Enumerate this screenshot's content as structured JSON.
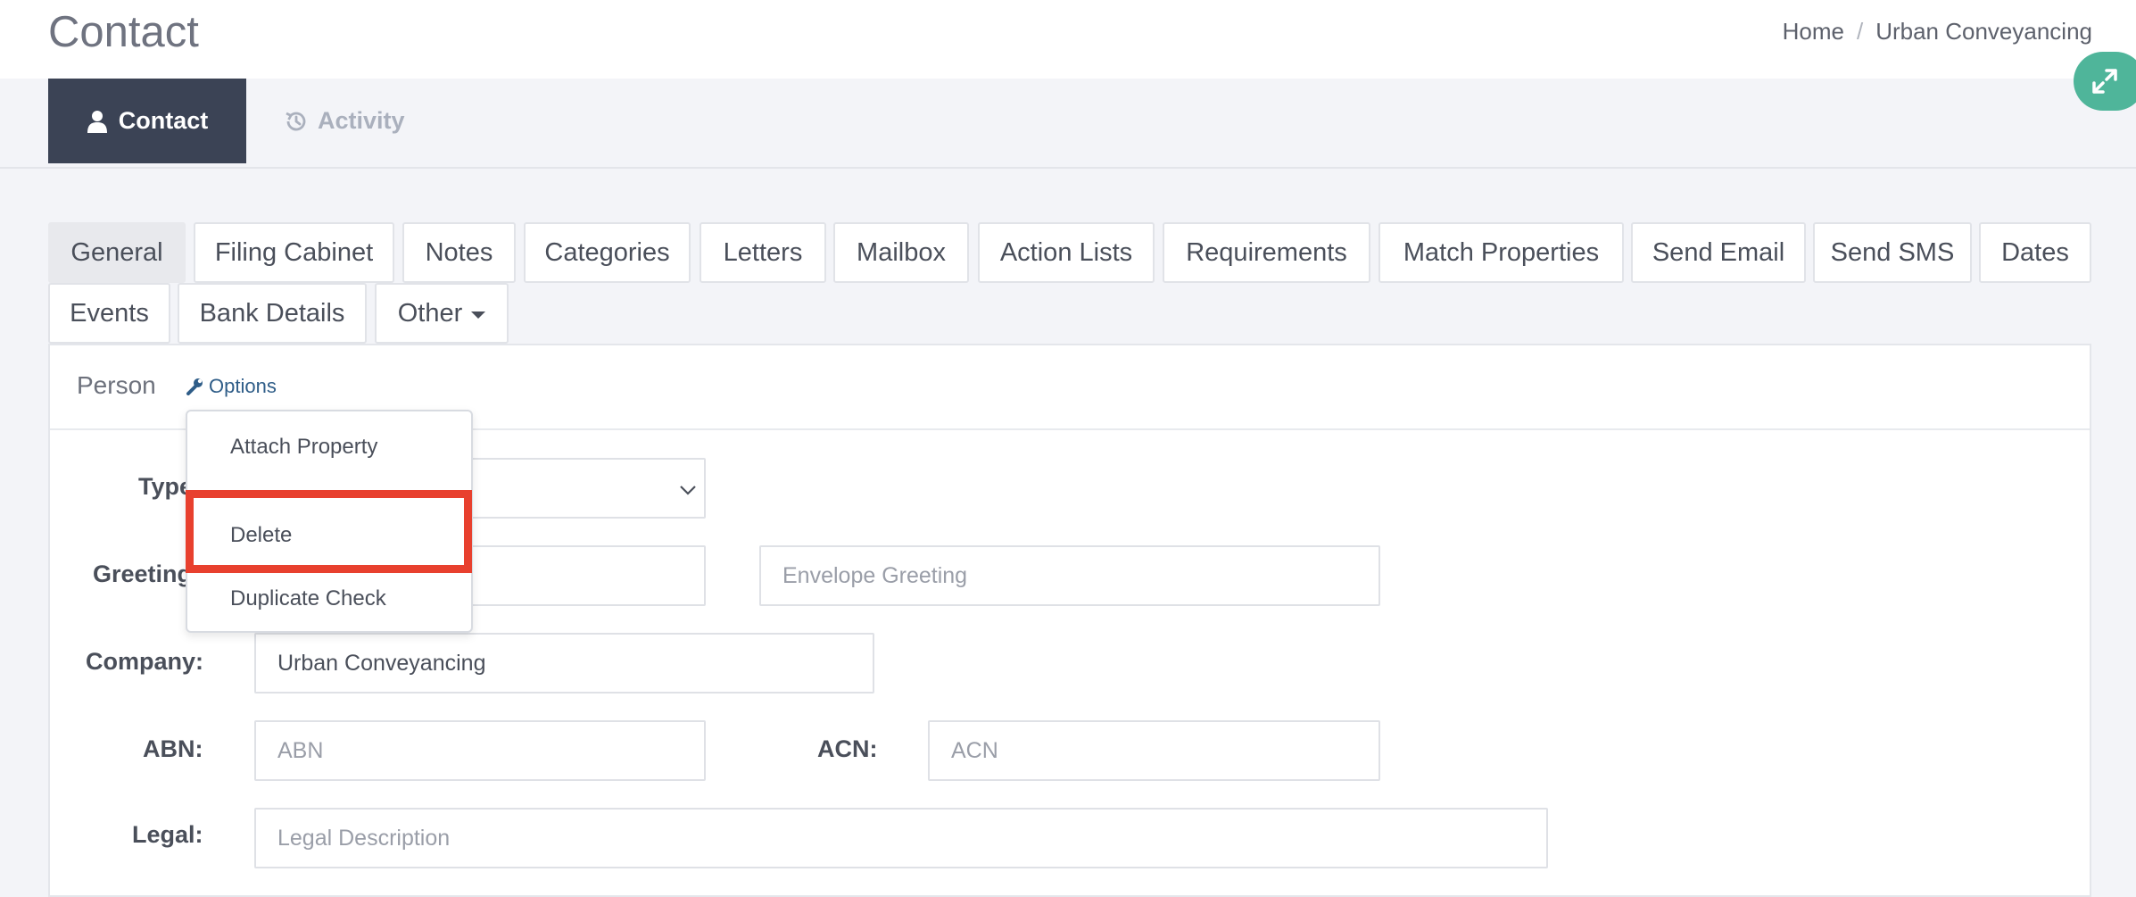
{
  "header": {
    "title": "Contact",
    "breadcrumb": [
      "Home",
      "Urban Conveyancing"
    ]
  },
  "main_tabs": [
    {
      "label": "Contact",
      "icon": "user-icon",
      "active": true
    },
    {
      "label": "Activity",
      "icon": "history-icon",
      "active": false
    }
  ],
  "sub_tabs": {
    "items": [
      "General",
      "Filing Cabinet",
      "Notes",
      "Categories",
      "Letters",
      "Mailbox",
      "Action Lists",
      "Requirements",
      "Match Properties",
      "Send Email",
      "Send SMS",
      "Dates",
      "Events",
      "Bank Details",
      "Other"
    ],
    "active": "General"
  },
  "panel": {
    "title": "Person",
    "options_label": "Options"
  },
  "options_menu": {
    "items": [
      "Attach Property",
      "Delete",
      "Duplicate Check"
    ],
    "highlighted": "Delete"
  },
  "form": {
    "type_label": "Type",
    "greeting_label": "Greeting",
    "envelope_greeting_placeholder": "Envelope Greeting",
    "company_label": "Company:",
    "company_value": "Urban Conveyancing",
    "abn_label": "ABN:",
    "abn_placeholder": "ABN",
    "acn_label": "ACN:",
    "acn_placeholder": "ACN",
    "legal_label": "Legal:",
    "legal_placeholder": "Legal Description"
  },
  "colors": {
    "active_main_tab": "#3b4355",
    "highlight": "#e8402e",
    "fab": "#4fb59a",
    "link": "#2f5d88"
  }
}
